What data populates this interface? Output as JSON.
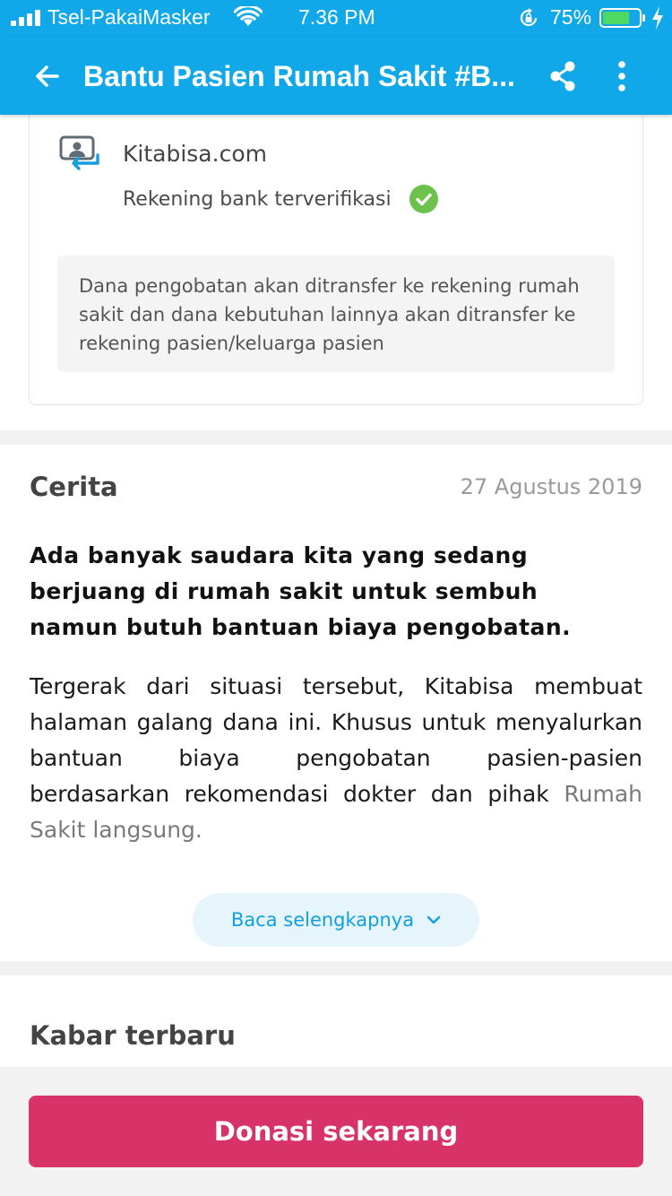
{
  "status_bar": {
    "carrier": "Tsel-PakaiMasker",
    "time": "7.36 PM",
    "battery_percent": "75%",
    "battery_level": 0.75,
    "signal_icon": "signal-bars-icon",
    "wifi_icon": "wifi-icon"
  },
  "app_bar": {
    "title": "Bantu Pasien Rumah Sakit #B...",
    "back_icon": "arrow-back-icon",
    "share_icon": "share-icon",
    "more_icon": "more-vertical-icon",
    "color": "#10a8e8"
  },
  "account": {
    "name": "Kitabisa.com",
    "verified_label": "Rekening bank terverifikasi",
    "notice": "Dana pengobatan akan ditransfer ke rekening rumah sakit dan dana kebutuhan lainnya akan ditransfer ke rekening pasien/keluarga pasien",
    "verified_color": "#6cc24a"
  },
  "story": {
    "heading": "Cerita",
    "date": "27 Agustus 2019",
    "lead": "Ada banyak saudara kita yang  sedang berjuang di rumah sakit untuk sembuh namun butuh bantuan biaya pengobatan.",
    "body": "Tergerak dari situasi tersebut, Kitabisa membuat halaman galang dana ini. Khusus untuk menyalurkan bantuan biaya pengobatan pasien-pasien berdasarkan rekomendasi dokter dan pihak",
    "body_tail": "Rumah Sakit langsung.",
    "read_more": "Baca selengkapnya"
  },
  "updates": {
    "heading": "Kabar terbaru"
  },
  "cta": {
    "donate": "Donasi sekarang",
    "color": "#d83368"
  }
}
